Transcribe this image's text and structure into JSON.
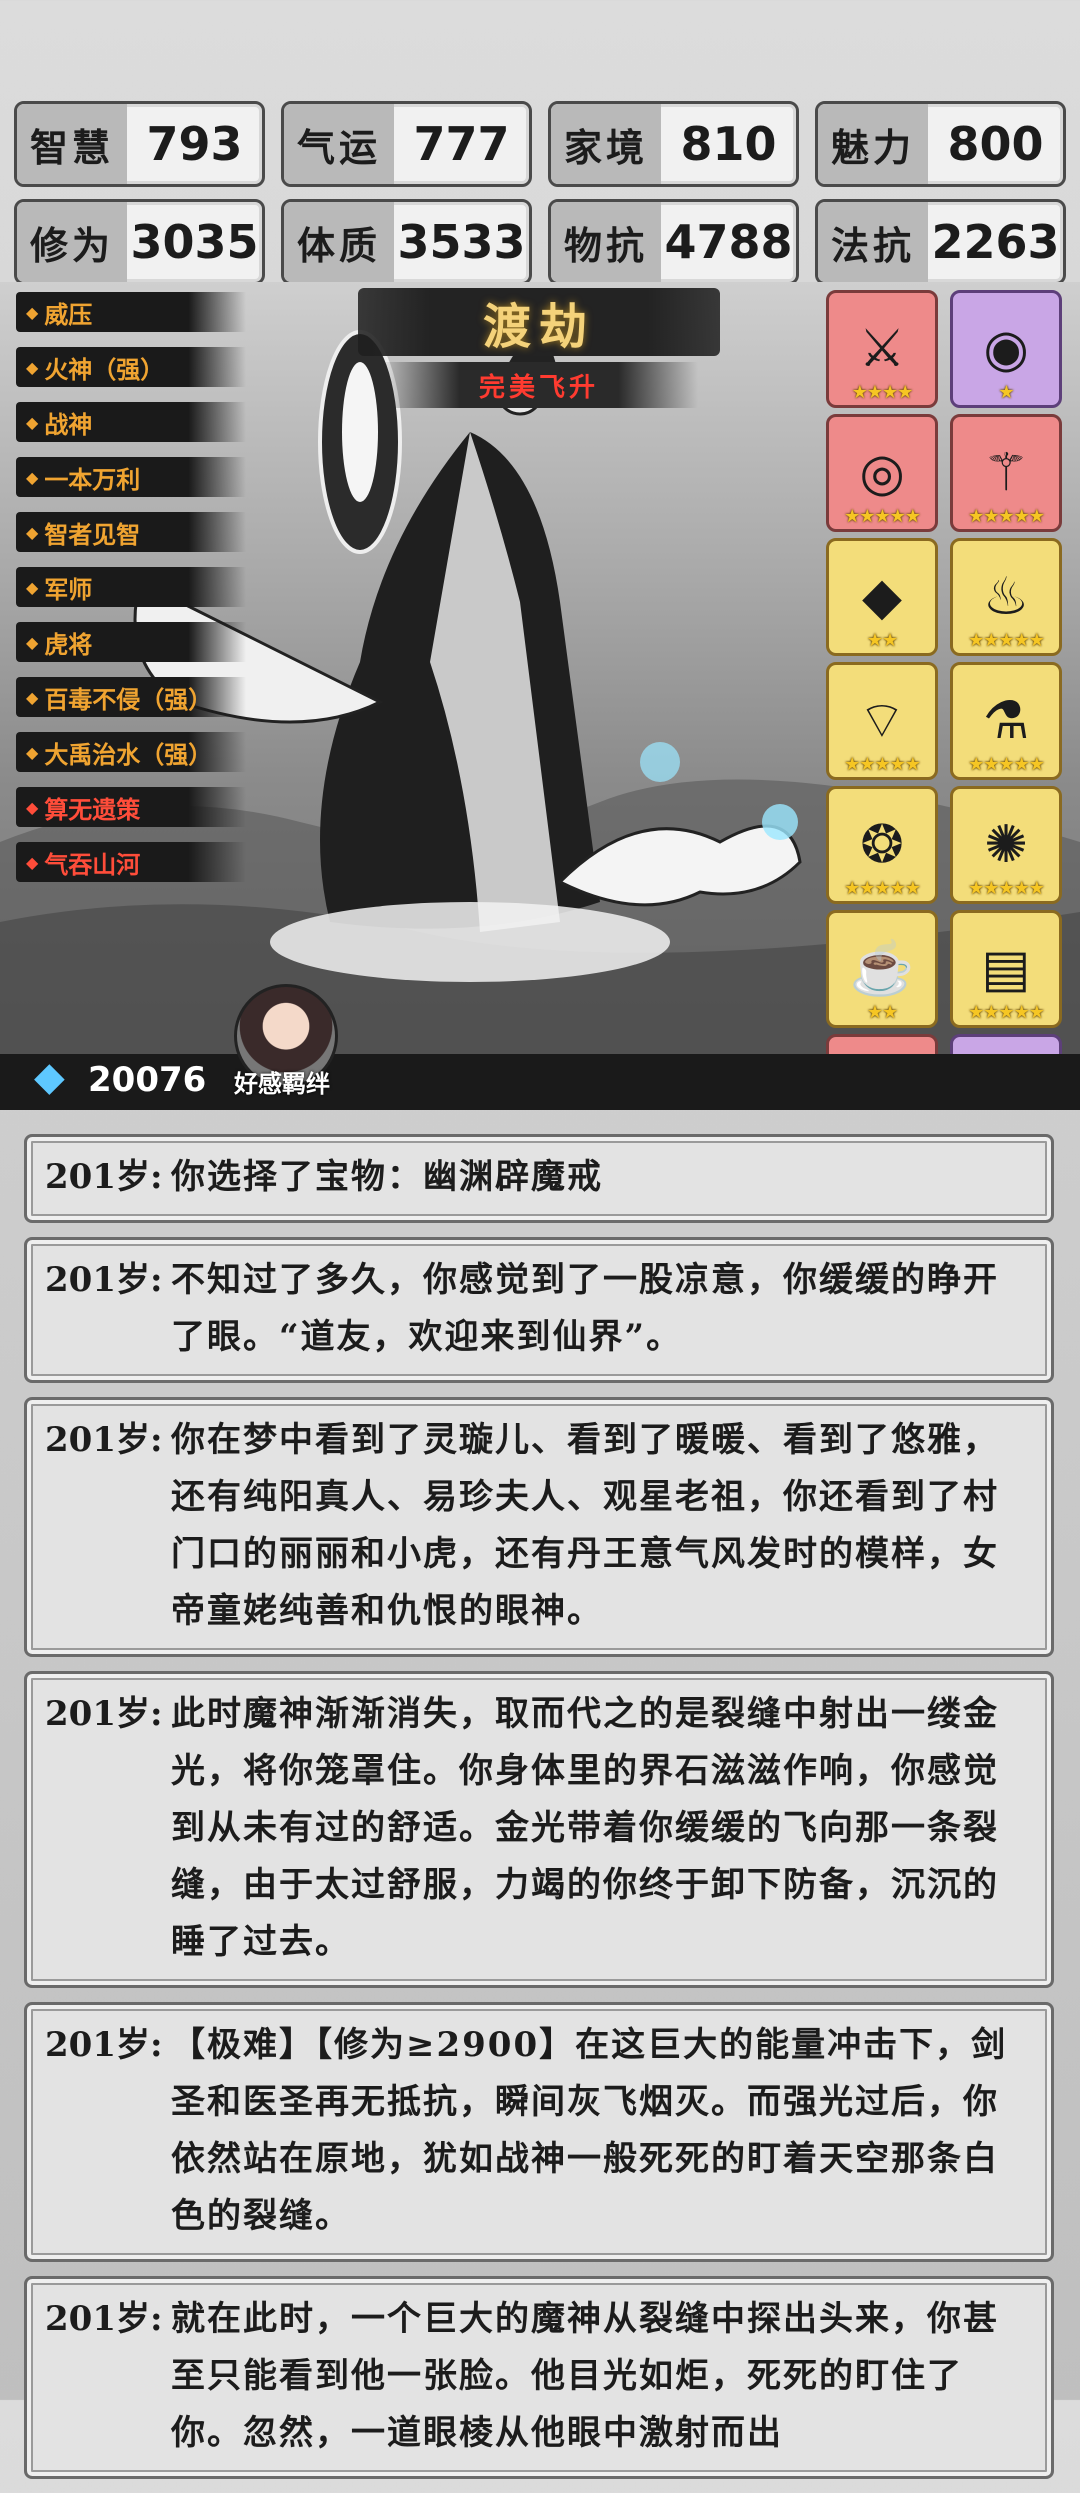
{
  "stats": [
    {
      "label": "智慧",
      "value": "793"
    },
    {
      "label": "气运",
      "value": "777"
    },
    {
      "label": "家境",
      "value": "810"
    },
    {
      "label": "魅力",
      "value": "800"
    },
    {
      "label": "修为",
      "value": "3035"
    },
    {
      "label": "体质",
      "value": "3533"
    },
    {
      "label": "物抗",
      "value": "4788"
    },
    {
      "label": "法抗",
      "value": "2263"
    }
  ],
  "skills": [
    {
      "label": "威压",
      "color": "#f0a431"
    },
    {
      "label": "火神（强）",
      "color": "#f0a431"
    },
    {
      "label": "战神",
      "color": "#f0a431"
    },
    {
      "label": "一本万利",
      "color": "#f0a431"
    },
    {
      "label": "智者见智",
      "color": "#f0a431"
    },
    {
      "label": "军师",
      "color": "#f0a431"
    },
    {
      "label": "虎将",
      "color": "#f0a431"
    },
    {
      "label": "百毒不侵（强）",
      "color": "#f0a431"
    },
    {
      "label": "大禹治水（强）",
      "color": "#f0a431"
    },
    {
      "label": "算无遗策",
      "color": "#ff4d3a"
    },
    {
      "label": "气吞山河",
      "color": "#ff4d3a"
    }
  ],
  "stage": {
    "title": "渡劫",
    "subtitle": "完美飞升"
  },
  "items": [
    {
      "icon": "spear-icon",
      "glyph": "⚔",
      "rarity": "red",
      "stars": "★★★★"
    },
    {
      "icon": "orb-icon",
      "glyph": "◉",
      "rarity": "purple",
      "stars": "★"
    },
    {
      "icon": "mirror-icon",
      "glyph": "◎",
      "rarity": "red",
      "stars": "★★★★★"
    },
    {
      "icon": "staff-icon",
      "glyph": "⚚",
      "rarity": "red",
      "stars": "★★★★★"
    },
    {
      "icon": "crystal-icon",
      "glyph": "◆",
      "rarity": "yellow",
      "stars": "★★"
    },
    {
      "icon": "phoenix-statue-icon",
      "glyph": "♨",
      "rarity": "yellow",
      "stars": "★★★★★"
    },
    {
      "icon": "fan-icon",
      "glyph": "⌔",
      "rarity": "yellow",
      "stars": "★★★★★"
    },
    {
      "icon": "bottle-icon",
      "glyph": "⚗",
      "rarity": "yellow",
      "stars": "★★★★★"
    },
    {
      "icon": "flame-armor-icon",
      "glyph": "❂",
      "rarity": "yellow",
      "stars": "★★★★★"
    },
    {
      "icon": "fire-ring-icon",
      "glyph": "✺",
      "rarity": "yellow",
      "stars": "★★★★★"
    },
    {
      "icon": "teapot-icon",
      "glyph": "☕",
      "rarity": "yellow",
      "stars": "★★"
    },
    {
      "icon": "scroll-icon",
      "glyph": "▤",
      "rarity": "yellow",
      "stars": "★★★★★"
    },
    {
      "icon": "sword-icon",
      "glyph": "🗡",
      "rarity": "red",
      "stars": "★★★★★"
    },
    {
      "icon": "ring-icon",
      "glyph": "◍",
      "rarity": "purple",
      "stars": "★"
    }
  ],
  "currency": {
    "icon": "gem-icon",
    "amount": "20076"
  },
  "bond_label": "好感羁绊",
  "log": [
    {
      "age": "201岁:",
      "text": "你选择了宝物：幽渊辟魔戒"
    },
    {
      "age": "201岁:",
      "text": "不知过了多久，你感觉到了一股凉意，你缓缓的睁开了眼。“道友，欢迎来到仙界”。"
    },
    {
      "age": "201岁:",
      "text": "你在梦中看到了灵璇儿、看到了暖暖、看到了悠雅，还有纯阳真人、易珍夫人、观星老祖，你还看到了村门口的丽丽和小虎，还有丹王意气风发时的模样，女帝童姥纯善和仇恨的眼神。"
    },
    {
      "age": "201岁:",
      "text": "此时魔神渐渐消失，取而代之的是裂缝中射出一缕金光，将你笼罩住。你身体里的界石滋滋作响，你感觉到从未有过的舒适。金光带着你缓缓的飞向那一条裂缝，由于太过舒服，力竭的你终于卸下防备，沉沉的睡了过去。"
    },
    {
      "age": "201岁:",
      "text": "【极难】【修为≥2900】在这巨大的能量冲击下，剑圣和医圣再无抵抗，瞬间灰飞烟灭。而强光过后，你依然站在原地，犹如战神一般死死的盯着天空那条白色的裂缝。"
    },
    {
      "age": "201岁:",
      "text": "就在此时，一个巨大的魔神从裂缝中探出头来，你甚至只能看到他一张脸。他目光如炬，死死的盯住了你。忽然，一道眼棱从他眼中激射而出"
    }
  ]
}
